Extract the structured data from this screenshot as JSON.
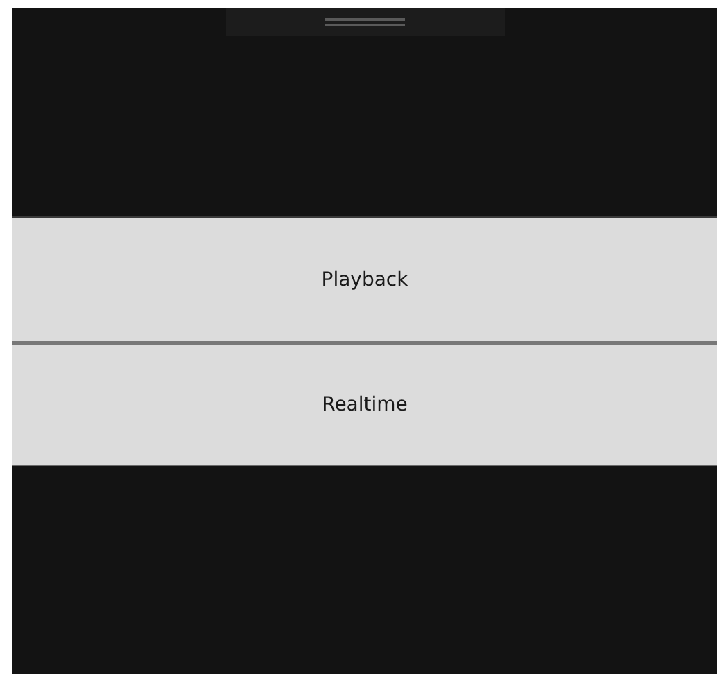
{
  "menu": [
    {
      "label": "Playback"
    },
    {
      "label": "Realtime"
    }
  ]
}
